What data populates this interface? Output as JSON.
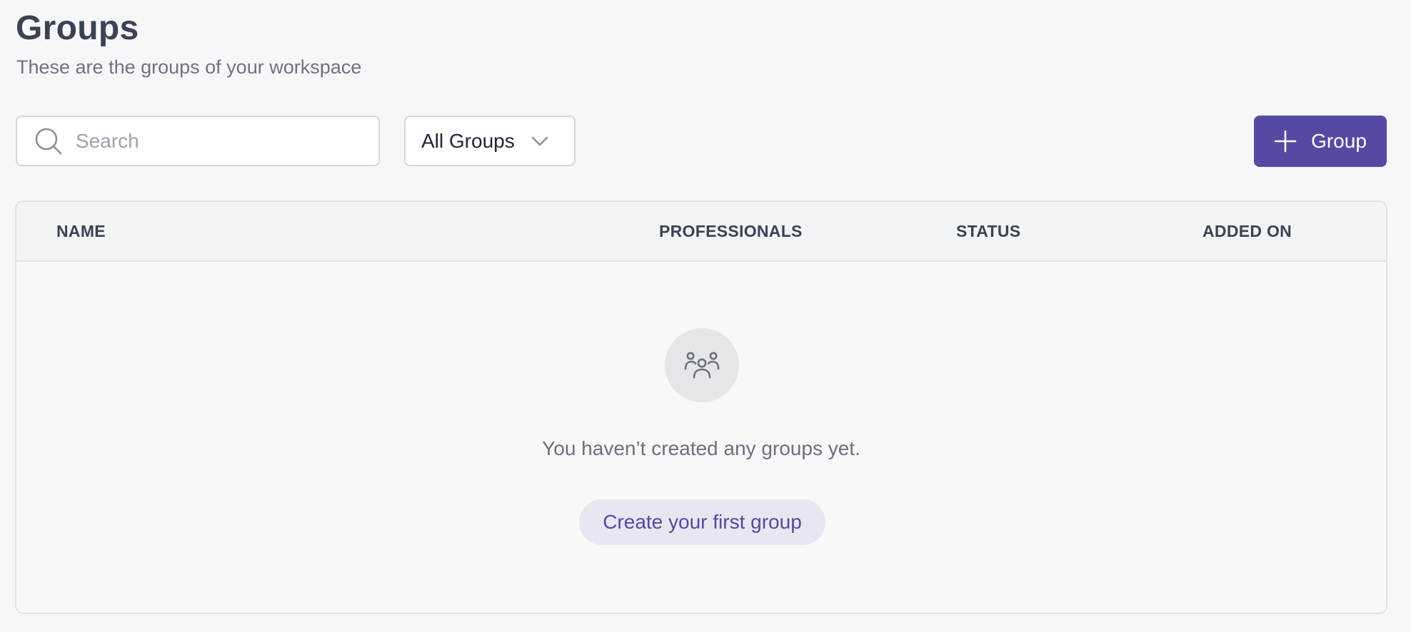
{
  "header": {
    "title": "Groups",
    "subtitle": "These are the groups of your workspace"
  },
  "toolbar": {
    "search_placeholder": "Search",
    "search_value": "",
    "filter_selected": "All Groups",
    "add_button_label": "Group",
    "accent_color": "#5449a3"
  },
  "table": {
    "columns": [
      "NAME",
      "PROFESSIONALS",
      "STATUS",
      "ADDED ON"
    ],
    "rows": []
  },
  "empty_state": {
    "icon": "users-icon",
    "message": "You haven’t created any groups yet.",
    "cta_label": "Create your first group"
  },
  "icons": {
    "search": "search-icon",
    "filter_chevron": "chevron-down-icon",
    "add": "plus-icon"
  }
}
